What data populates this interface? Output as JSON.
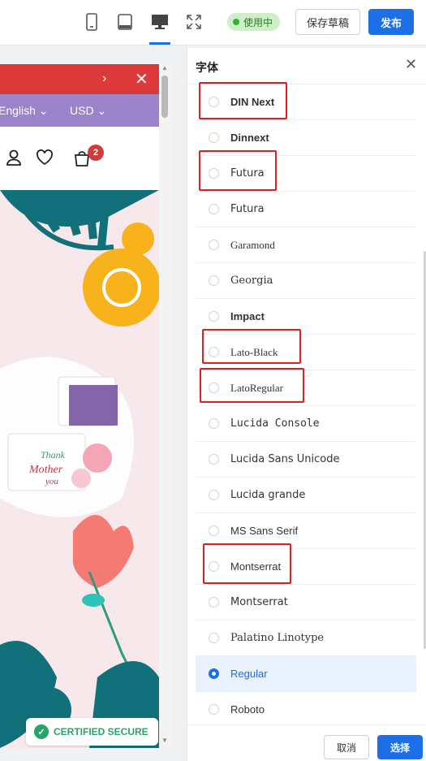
{
  "topbar": {
    "devices": [
      {
        "name": "mobile",
        "icon": "phone-icon"
      },
      {
        "name": "tablet",
        "icon": "tablet-icon"
      },
      {
        "name": "desktop",
        "icon": "desktop-icon",
        "active": true
      },
      {
        "name": "fullscreen",
        "icon": "fullscreen-icon"
      }
    ],
    "status_label": "使用中",
    "save_draft_label": "保存草稿",
    "publish_label": "发布"
  },
  "preview": {
    "announcement_arrow": "›",
    "announcement_close": "✕",
    "language": "English ⌄",
    "currency": "USD ⌄",
    "cart_count": "2",
    "certified_label": "CERTIFIED SECURE",
    "card_text_1": "Thank",
    "card_text_2": "Mother",
    "card_text_3": "you"
  },
  "font_panel": {
    "title": "字体",
    "fonts": [
      {
        "label": "DIN Next",
        "selected": false
      },
      {
        "label": "Dinnext",
        "selected": false
      },
      {
        "label": "Futura",
        "selected": false
      },
      {
        "label": "Futura",
        "selected": false
      },
      {
        "label": "Garamond",
        "selected": false
      },
      {
        "label": "Georgia",
        "selected": false
      },
      {
        "label": "Impact",
        "selected": false
      },
      {
        "label": "Lato-Black",
        "selected": false
      },
      {
        "label": "LatoRegular",
        "selected": false
      },
      {
        "label": "Lucida Console",
        "selected": false
      },
      {
        "label": "Lucida Sans Unicode",
        "selected": false
      },
      {
        "label": "Lucida grande",
        "selected": false
      },
      {
        "label": "MS Sans Serif",
        "selected": false
      },
      {
        "label": "Montserrat",
        "selected": false
      },
      {
        "label": "Montserrat",
        "selected": false
      },
      {
        "label": "Palatino Linotype",
        "selected": false
      },
      {
        "label": "Regular",
        "selected": true
      },
      {
        "label": "Roboto",
        "selected": false
      }
    ],
    "cancel_label": "取消",
    "confirm_label": "选择"
  },
  "colors": {
    "accent": "#1c6fe6",
    "highlight": "#e02020",
    "announcement": "#dc3a3a",
    "lang_bar": "#9b84c9"
  }
}
